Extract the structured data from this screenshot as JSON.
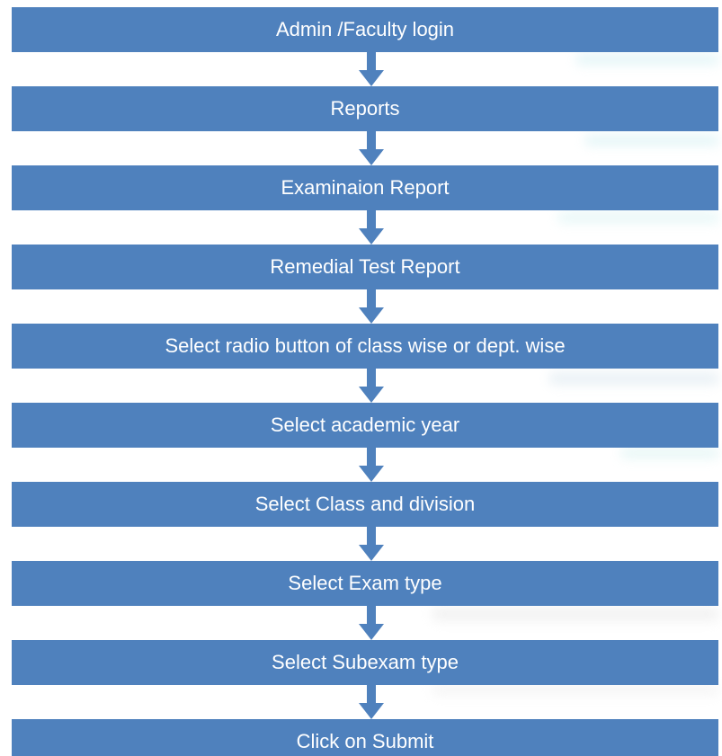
{
  "flowchart": {
    "colors": {
      "box_fill": "#4f81bd",
      "box_text": "#ffffff",
      "arrow_fill": "#4f81bd"
    },
    "steps": [
      {
        "label": "Admin /Faculty login"
      },
      {
        "label": "Reports"
      },
      {
        "label": "Examinaion Report"
      },
      {
        "label": "Remedial Test Report"
      },
      {
        "label": "Select radio button of class wise or dept. wise"
      },
      {
        "label": "Select academic year"
      },
      {
        "label": "Select Class and division"
      },
      {
        "label": "Select Exam type"
      },
      {
        "label": "Select Subexam type"
      },
      {
        "label": "Click on Submit"
      }
    ],
    "arrow_icon": "down-arrow-icon"
  }
}
